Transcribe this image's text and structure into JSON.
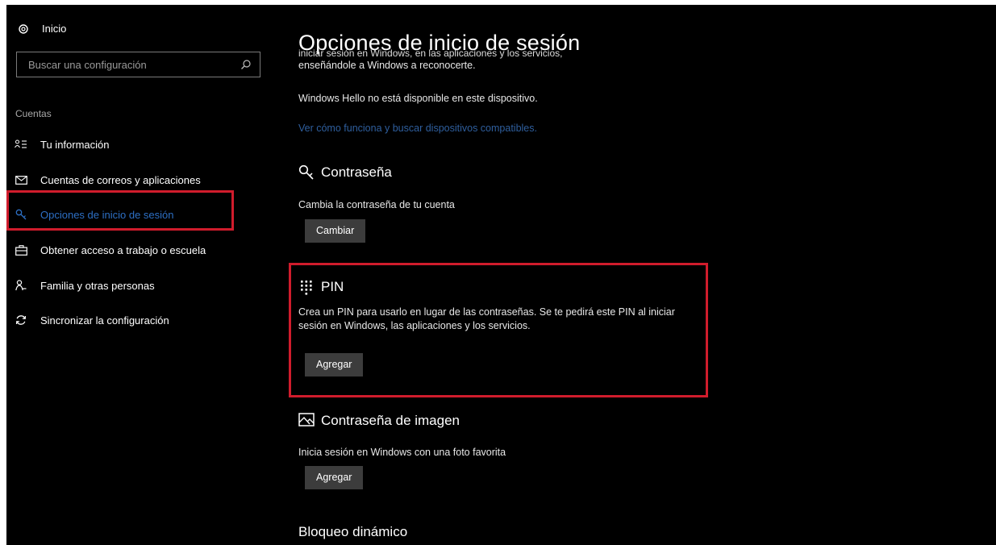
{
  "sidebar": {
    "home_label": "Inicio",
    "search_placeholder": "Buscar una configuración",
    "section_title": "Cuentas",
    "items": [
      {
        "label": "Tu información",
        "icon": "person-info-icon"
      },
      {
        "label": "Cuentas de correos y aplicaciones",
        "icon": "mail-icon"
      },
      {
        "label": "Opciones de inicio de sesión",
        "icon": "key-icon",
        "active": true
      },
      {
        "label": "Obtener acceso a trabajo o escuela",
        "icon": "briefcase-icon"
      },
      {
        "label": "Familia y otras personas",
        "icon": "people-icon"
      },
      {
        "label": "Sincronizar la configuración",
        "icon": "sync-icon"
      }
    ]
  },
  "main": {
    "title": "Opciones de inicio de sesión",
    "hello_clipped_line": "iniciar sesión en Windows, en las aplicaciones y los servicios,",
    "hello_line2": "enseñándole a Windows a reconocerte.",
    "hello_unavailable": "Windows Hello no está disponible en este dispositivo.",
    "hello_link": "Ver cómo funciona y buscar dispositivos compatibles.",
    "password": {
      "title": "Contraseña",
      "description": "Cambia la contraseña de tu cuenta",
      "button": "Cambiar"
    },
    "pin": {
      "title": "PIN",
      "description": "Crea un PIN para usarlo en lugar de las contraseñas. Se te pedirá este PIN al iniciar sesión en Windows, las aplicaciones y los servicios.",
      "button": "Agregar"
    },
    "picture_password": {
      "title": "Contraseña de imagen",
      "description": "Inicia sesión en Windows con una foto favorita",
      "button": "Agregar"
    },
    "dynamic_lock": {
      "title": "Bloqueo dinámico"
    }
  },
  "colors": {
    "background": "#000000",
    "accent": "#2d6fc4",
    "link": "#2f5f9e",
    "highlight": "#d01c2c",
    "button": "#3c3c3c"
  }
}
